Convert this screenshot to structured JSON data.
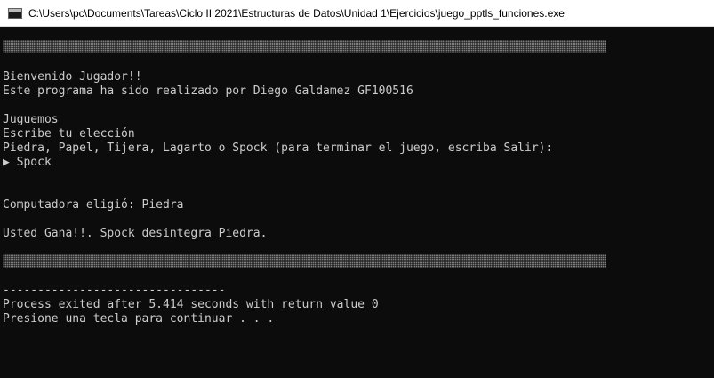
{
  "window": {
    "title": "C:\\Users\\pc\\Documents\\Tareas\\Ciclo II 2021\\Estructuras de Datos\\Unidad 1\\Ejercicios\\juego_pptls_funciones.exe"
  },
  "console": {
    "welcome": "Bienvenido Jugador!!",
    "author": "Este programa ha sido realizado por Diego Galdamez GF100516",
    "lets_play": "Juguemos",
    "prompt_choice": "Escribe tu elección",
    "options": "Piedra, Papel, Tijera, Lagarto o Spock (para terminar el juego, escriba Salir):",
    "input_marker": "▶",
    "user_input": "Spock",
    "computer_choice": "Computadora eligió: Piedra",
    "result": "Usted Gana!!. Spock desintegra Piedra.",
    "separator": "--------------------------------",
    "process_exit": "Process exited after 5.414 seconds with return value 0",
    "press_key": "Presione una tecla para continuar . . ."
  },
  "colors": {
    "console_bg": "#0c0c0c",
    "console_text": "#cccccc",
    "shade_bar": "#7e7e7e",
    "titlebar_bg": "#ffffff"
  }
}
